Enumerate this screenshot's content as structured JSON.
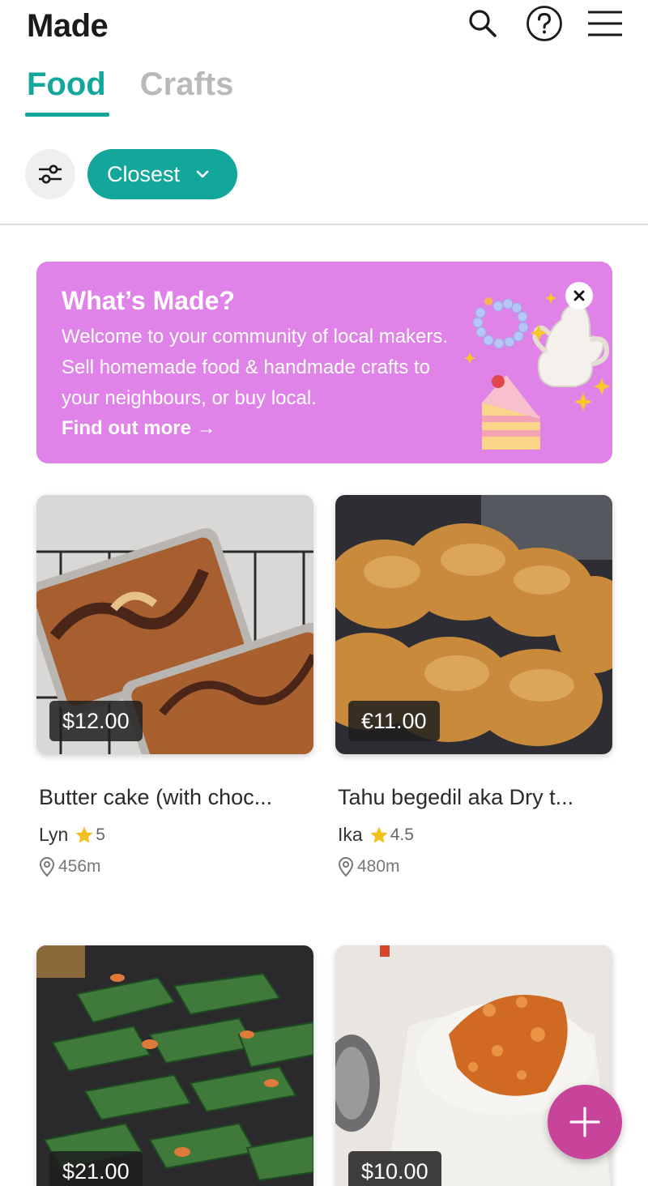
{
  "app": {
    "title": "Made"
  },
  "header": {
    "icons": [
      "search-icon",
      "help-icon",
      "menu-icon"
    ]
  },
  "tabs": [
    {
      "label": "Food",
      "active": true
    },
    {
      "label": "Crafts",
      "active": false
    }
  ],
  "filters": {
    "filter_icon": "sliders-icon",
    "sort_label": "Closest"
  },
  "banner": {
    "title": "What’s Made?",
    "text": "Welcome to your community of local makers. Sell homemade food & handmade crafts to your neighbours, or buy local.",
    "link": "Find out more →"
  },
  "products": [
    {
      "price": "$12.00",
      "title": "Butter cake (with choc...",
      "seller": "Lyn",
      "rating": "5",
      "distance": "456m"
    },
    {
      "price": "€11.00",
      "title": "Tahu begedil aka Dry t...",
      "seller": "Ika",
      "rating": "4.5",
      "distance": "480m"
    },
    {
      "price": "$21.00",
      "title": "",
      "seller": "",
      "rating": "",
      "distance": ""
    },
    {
      "price": "$10.00",
      "title": "",
      "seller": "",
      "rating": "",
      "distance": ""
    }
  ],
  "colors": {
    "accent": "#13a79b",
    "banner": "#e083e8",
    "fab": "#c8449a",
    "star": "#f2c01e"
  }
}
